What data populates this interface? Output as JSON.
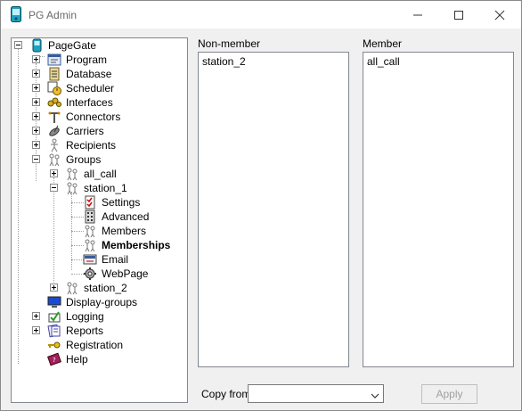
{
  "window": {
    "title": "PG Admin"
  },
  "tree": {
    "root": "PageGate",
    "items": [
      {
        "label": "Program",
        "icon": "program-icon"
      },
      {
        "label": "Database",
        "icon": "database-icon"
      },
      {
        "label": "Scheduler",
        "icon": "scheduler-icon"
      },
      {
        "label": "Interfaces",
        "icon": "interfaces-icon"
      },
      {
        "label": "Connectors",
        "icon": "connectors-icon"
      },
      {
        "label": "Carriers",
        "icon": "carriers-icon"
      },
      {
        "label": "Recipients",
        "icon": "recipients-icon"
      },
      {
        "label": "Groups",
        "icon": "groups-icon"
      },
      {
        "label": "all_call",
        "icon": "group-icon"
      },
      {
        "label": "station_1",
        "icon": "group-icon"
      },
      {
        "label": "Settings",
        "icon": "settings-icon"
      },
      {
        "label": "Advanced",
        "icon": "advanced-icon"
      },
      {
        "label": "Members",
        "icon": "members-icon"
      },
      {
        "label": "Memberships",
        "icon": "memberships-icon"
      },
      {
        "label": "Email",
        "icon": "email-icon"
      },
      {
        "label": "WebPage",
        "icon": "webpage-icon"
      },
      {
        "label": "station_2",
        "icon": "group-icon"
      },
      {
        "label": "Display-groups",
        "icon": "display-groups-icon"
      },
      {
        "label": "Logging",
        "icon": "logging-icon"
      },
      {
        "label": "Reports",
        "icon": "reports-icon"
      },
      {
        "label": "Registration",
        "icon": "key-icon"
      },
      {
        "label": "Help",
        "icon": "help-book-icon"
      }
    ]
  },
  "panels": {
    "nonmember": {
      "label": "Non-member",
      "items": [
        "station_2"
      ]
    },
    "member": {
      "label": "Member",
      "items": [
        "all_call"
      ]
    }
  },
  "footer": {
    "copy_from_label": "Copy from",
    "copy_from_value": "",
    "apply_label": "Apply"
  },
  "colors": {
    "tree_border": "#828790",
    "disabled_text": "#a0a0a0"
  }
}
